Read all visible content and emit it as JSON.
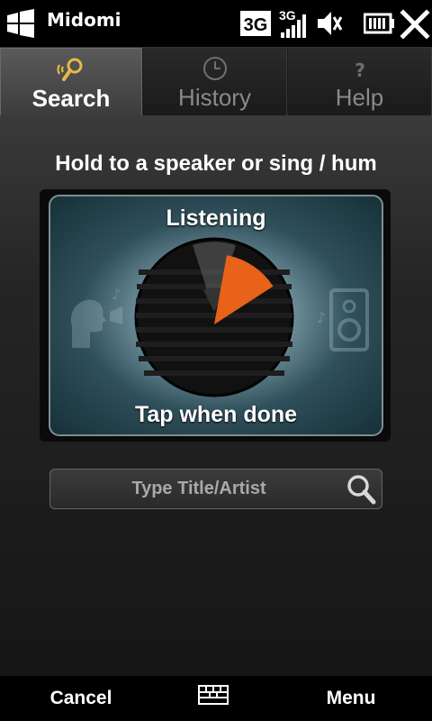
{
  "status_bar": {
    "app_title": "Midomi",
    "network_label": "3G",
    "signal_label": "3G",
    "icons": [
      "windows-start-icon",
      "data-3g-icon",
      "signal-3g-icon",
      "volume-muted-icon",
      "battery-icon",
      "close-icon"
    ]
  },
  "tabs": [
    {
      "label": "Search",
      "icon": "search-listen-icon",
      "active": true
    },
    {
      "label": "History",
      "icon": "clock-icon",
      "active": false
    },
    {
      "label": "Help",
      "icon": "question-icon",
      "active": false
    }
  ],
  "main": {
    "instruction": "Hold to a speaker or sing / hum",
    "panel": {
      "status": "Listening",
      "action": "Tap when done",
      "progress": 0.13,
      "accent_color": "#e8621a"
    },
    "search": {
      "placeholder": "Type Title/Artist"
    }
  },
  "bottom_bar": {
    "left_label": "Cancel",
    "right_label": "Menu",
    "center_icon": "keyboard-icon"
  }
}
